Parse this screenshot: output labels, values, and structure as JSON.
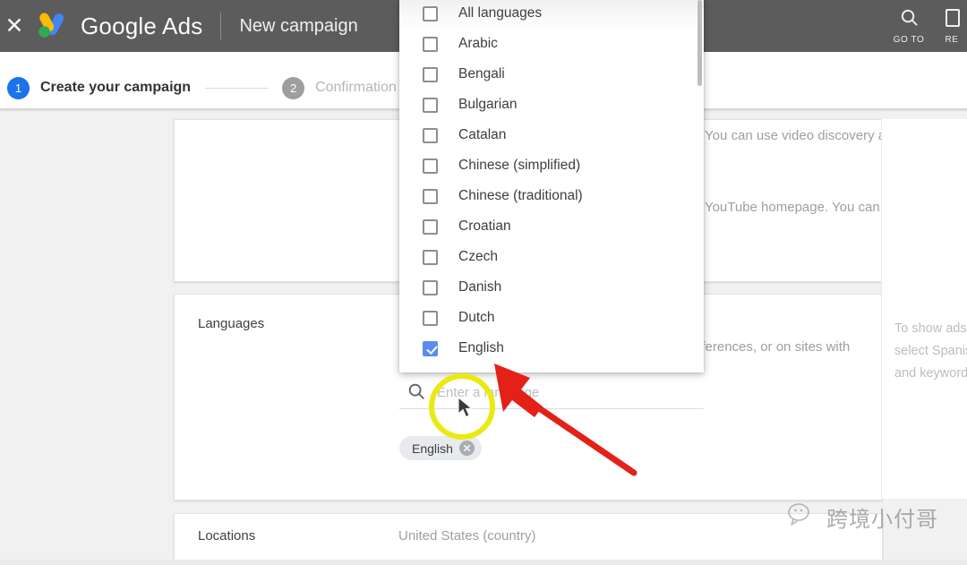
{
  "topbar": {
    "close_icon": "close-icon",
    "logo_icon": "google-ads-logo",
    "brand": "Google Ads",
    "subtitle": "New campaign",
    "right_items": [
      {
        "icon": "search-icon",
        "label": "GO TO"
      },
      {
        "icon": "reports-icon",
        "label": "RE"
      }
    ]
  },
  "stepper": {
    "steps": [
      {
        "num": "1",
        "label": "Create your campaign",
        "active": true
      },
      {
        "num": "2",
        "label": "Confirmation",
        "active": false
      }
    ]
  },
  "networks_card": {
    "clipped_line_1": "You can use video discovery ads only.",
    "clipped_line_2": "and the YouTube homepage. You can use in-s"
  },
  "languages_card": {
    "label": "Languages",
    "clipped_line": "eferences, or on sites with",
    "search": {
      "icon": "search-icon",
      "placeholder": "Enter a language",
      "value": ""
    },
    "chips": [
      {
        "label": "English",
        "remove_icon": "close-circle-icon"
      }
    ]
  },
  "locations_card": {
    "label": "Locations",
    "value": "United States (country)"
  },
  "tip_panel": {
    "text": "To show ads Spanish as a select Spanis language and and keywords"
  },
  "dropdown": {
    "scrollbar": "vertical-scrollbar",
    "options": [
      {
        "label": "All languages",
        "checked": false
      },
      {
        "label": "Arabic",
        "checked": false
      },
      {
        "label": "Bengali",
        "checked": false
      },
      {
        "label": "Bulgarian",
        "checked": false
      },
      {
        "label": "Catalan",
        "checked": false
      },
      {
        "label": "Chinese (simplified)",
        "checked": false
      },
      {
        "label": "Chinese (traditional)",
        "checked": false
      },
      {
        "label": "Croatian",
        "checked": false
      },
      {
        "label": "Czech",
        "checked": false
      },
      {
        "label": "Danish",
        "checked": false
      },
      {
        "label": "Dutch",
        "checked": false
      },
      {
        "label": "English",
        "checked": true
      }
    ]
  },
  "annotations": {
    "highlight_circle": "yellow-highlight-circle",
    "arrow": "red-arrow-annotation",
    "cursor": "mouse-cursor"
  },
  "watermark": {
    "icon": "wechat-icon",
    "text": "跨境小付哥"
  },
  "colors": {
    "accent_blue": "#1a73e8",
    "checkbox_blue": "#5b8def",
    "topbar_gray": "#5c5c5c",
    "annotation_red": "#e32119",
    "annotation_yellow": "#eaea10"
  }
}
